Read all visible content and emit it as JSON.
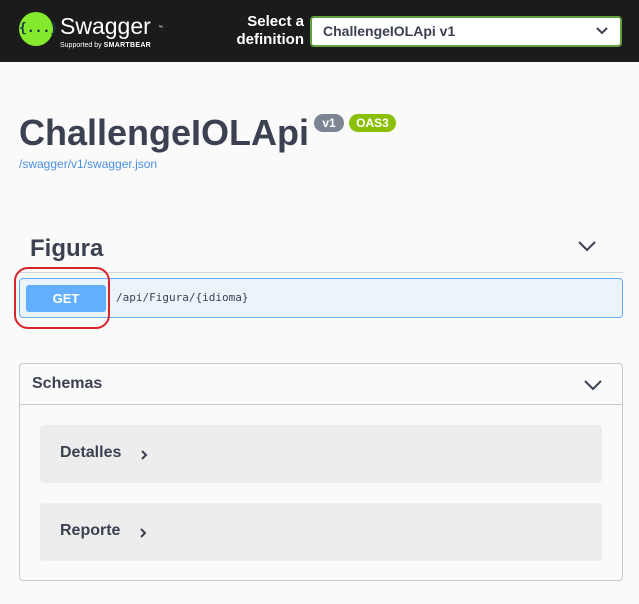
{
  "topbar": {
    "logo_glyph": "{...}",
    "brand": "Swagger",
    "brand_tm": "™",
    "tagline_prefix": "Supported by",
    "tagline_brand": "SMARTBEAR",
    "select_label": "Select a definition",
    "selected_definition": "ChallengeIOLApi v1"
  },
  "info": {
    "title": "ChallengeIOLApi",
    "version_badge": "v1",
    "oas_badge": "OAS3",
    "spec_url": "/swagger/v1/swagger.json"
  },
  "tag": {
    "name": "Figura",
    "operation": {
      "method": "GET",
      "path": "/api/Figura/{idioma}"
    }
  },
  "schemas": {
    "title": "Schemas",
    "models": [
      {
        "name": "Detalles"
      },
      {
        "name": "Reporte"
      }
    ]
  },
  "colors": {
    "topbar_bg": "#1b1b1b",
    "logo_green": "#85ea2d",
    "select_border": "#62a03f",
    "get_blue": "#61affe",
    "get_bg": "#ebf3fb",
    "oas_badge": "#89bf04",
    "version_badge": "#7d8492",
    "highlight_red": "#d8232a",
    "link_blue": "#4990e2"
  },
  "icons": [
    "swagger-logo-icon",
    "chevron-down-icon",
    "chevron-right-icon"
  ]
}
